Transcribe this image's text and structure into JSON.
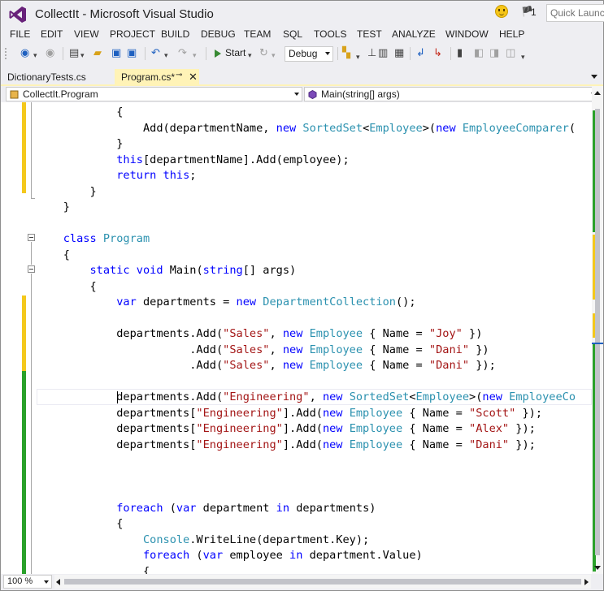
{
  "window": {
    "title": "CollectIt - Microsoft Visual Studio",
    "notification_count": "1",
    "quick_launch_placeholder": "Quick Launch"
  },
  "menu": [
    "FILE",
    "EDIT",
    "VIEW",
    "PROJECT",
    "BUILD",
    "DEBUG",
    "TEAM",
    "SQL",
    "TOOLS",
    "TEST",
    "ANALYZE",
    "WINDOW",
    "HELP"
  ],
  "toolbar": {
    "start_label": "Start",
    "configuration": "Debug"
  },
  "tabs": [
    {
      "label": "DictionaryTests.cs",
      "active": false
    },
    {
      "label": "Program.cs*",
      "active": true
    }
  ],
  "navbar": {
    "type_scope": "CollectIt.Program",
    "member_scope": "Main(string[] args)"
  },
  "editor": {
    "zoom": "100 %",
    "lines": [
      [
        {
          "t": "            {",
          "c": ""
        }
      ],
      [
        {
          "t": "                Add(departmentName, ",
          "c": ""
        },
        {
          "t": "new",
          "c": "kw"
        },
        {
          "t": " ",
          "c": ""
        },
        {
          "t": "SortedSet",
          "c": "ty"
        },
        {
          "t": "<",
          "c": ""
        },
        {
          "t": "Employee",
          "c": "ty"
        },
        {
          "t": ">(",
          "c": ""
        },
        {
          "t": "new",
          "c": "kw"
        },
        {
          "t": " ",
          "c": ""
        },
        {
          "t": "EmployeeComparer",
          "c": "ty"
        },
        {
          "t": "(",
          "c": ""
        }
      ],
      [
        {
          "t": "            }",
          "c": ""
        }
      ],
      [
        {
          "t": "            ",
          "c": ""
        },
        {
          "t": "this",
          "c": "kw"
        },
        {
          "t": "[departmentName].Add(employee);",
          "c": ""
        }
      ],
      [
        {
          "t": "            ",
          "c": ""
        },
        {
          "t": "return",
          "c": "kw"
        },
        {
          "t": " ",
          "c": ""
        },
        {
          "t": "this",
          "c": "kw"
        },
        {
          "t": ";",
          "c": ""
        }
      ],
      [
        {
          "t": "        }",
          "c": ""
        }
      ],
      [
        {
          "t": "    }",
          "c": ""
        }
      ],
      [
        {
          "t": "",
          "c": ""
        }
      ],
      [
        {
          "t": "    ",
          "c": ""
        },
        {
          "t": "class",
          "c": "kw"
        },
        {
          "t": " ",
          "c": ""
        },
        {
          "t": "Program",
          "c": "ty"
        }
      ],
      [
        {
          "t": "    {",
          "c": ""
        }
      ],
      [
        {
          "t": "        ",
          "c": ""
        },
        {
          "t": "static",
          "c": "kw"
        },
        {
          "t": " ",
          "c": ""
        },
        {
          "t": "void",
          "c": "kw"
        },
        {
          "t": " Main(",
          "c": ""
        },
        {
          "t": "string",
          "c": "kw"
        },
        {
          "t": "[] args)",
          "c": ""
        }
      ],
      [
        {
          "t": "        {",
          "c": ""
        }
      ],
      [
        {
          "t": "            ",
          "c": ""
        },
        {
          "t": "var",
          "c": "kw"
        },
        {
          "t": " departments = ",
          "c": ""
        },
        {
          "t": "new",
          "c": "kw"
        },
        {
          "t": " ",
          "c": ""
        },
        {
          "t": "DepartmentCollection",
          "c": "ty"
        },
        {
          "t": "();",
          "c": ""
        }
      ],
      [
        {
          "t": "",
          "c": ""
        }
      ],
      [
        {
          "t": "            departments.Add(",
          "c": ""
        },
        {
          "t": "\"Sales\"",
          "c": "str"
        },
        {
          "t": ", ",
          "c": ""
        },
        {
          "t": "new",
          "c": "kw"
        },
        {
          "t": " ",
          "c": ""
        },
        {
          "t": "Employee",
          "c": "ty"
        },
        {
          "t": " { Name = ",
          "c": ""
        },
        {
          "t": "\"Joy\"",
          "c": "str"
        },
        {
          "t": " })",
          "c": ""
        }
      ],
      [
        {
          "t": "                       .Add(",
          "c": ""
        },
        {
          "t": "\"Sales\"",
          "c": "str"
        },
        {
          "t": ", ",
          "c": ""
        },
        {
          "t": "new",
          "c": "kw"
        },
        {
          "t": " ",
          "c": ""
        },
        {
          "t": "Employee",
          "c": "ty"
        },
        {
          "t": " { Name = ",
          "c": ""
        },
        {
          "t": "\"Dani\"",
          "c": "str"
        },
        {
          "t": " })",
          "c": ""
        }
      ],
      [
        {
          "t": "                       .Add(",
          "c": ""
        },
        {
          "t": "\"Sales\"",
          "c": "str"
        },
        {
          "t": ", ",
          "c": ""
        },
        {
          "t": "new",
          "c": "kw"
        },
        {
          "t": " ",
          "c": ""
        },
        {
          "t": "Employee",
          "c": "ty"
        },
        {
          "t": " { Name = ",
          "c": ""
        },
        {
          "t": "\"Dani\"",
          "c": "str"
        },
        {
          "t": " });",
          "c": ""
        }
      ],
      [
        {
          "t": "",
          "c": ""
        }
      ],
      [
        {
          "t": "            departments.Add(",
          "c": ""
        },
        {
          "t": "\"Engineering\"",
          "c": "str"
        },
        {
          "t": ", ",
          "c": ""
        },
        {
          "t": "new",
          "c": "kw"
        },
        {
          "t": " ",
          "c": ""
        },
        {
          "t": "SortedSet",
          "c": "ty"
        },
        {
          "t": "<",
          "c": ""
        },
        {
          "t": "Employee",
          "c": "ty"
        },
        {
          "t": ">(",
          "c": ""
        },
        {
          "t": "new",
          "c": "kw"
        },
        {
          "t": " ",
          "c": ""
        },
        {
          "t": "EmployeeCo",
          "c": "ty"
        }
      ],
      [
        {
          "t": "            departments[",
          "c": ""
        },
        {
          "t": "\"Engineering\"",
          "c": "str"
        },
        {
          "t": "].Add(",
          "c": ""
        },
        {
          "t": "new",
          "c": "kw"
        },
        {
          "t": " ",
          "c": ""
        },
        {
          "t": "Employee",
          "c": "ty"
        },
        {
          "t": " { Name = ",
          "c": ""
        },
        {
          "t": "\"Scott\"",
          "c": "str"
        },
        {
          "t": " });",
          "c": ""
        }
      ],
      [
        {
          "t": "            departments[",
          "c": ""
        },
        {
          "t": "\"Engineering\"",
          "c": "str"
        },
        {
          "t": "].Add(",
          "c": ""
        },
        {
          "t": "new",
          "c": "kw"
        },
        {
          "t": " ",
          "c": ""
        },
        {
          "t": "Employee",
          "c": "ty"
        },
        {
          "t": " { Name = ",
          "c": ""
        },
        {
          "t": "\"Alex\"",
          "c": "str"
        },
        {
          "t": " });",
          "c": ""
        }
      ],
      [
        {
          "t": "            departments[",
          "c": ""
        },
        {
          "t": "\"Engineering\"",
          "c": "str"
        },
        {
          "t": "].Add(",
          "c": ""
        },
        {
          "t": "new",
          "c": "kw"
        },
        {
          "t": " ",
          "c": ""
        },
        {
          "t": "Employee",
          "c": "ty"
        },
        {
          "t": " { Name = ",
          "c": ""
        },
        {
          "t": "\"Dani\"",
          "c": "str"
        },
        {
          "t": " });",
          "c": ""
        }
      ],
      [
        {
          "t": "",
          "c": ""
        }
      ],
      [
        {
          "t": "",
          "c": ""
        }
      ],
      [
        {
          "t": "",
          "c": ""
        }
      ],
      [
        {
          "t": "            ",
          "c": ""
        },
        {
          "t": "foreach",
          "c": "kw"
        },
        {
          "t": " (",
          "c": ""
        },
        {
          "t": "var",
          "c": "kw"
        },
        {
          "t": " department ",
          "c": ""
        },
        {
          "t": "in",
          "c": "kw"
        },
        {
          "t": " departments)",
          "c": ""
        }
      ],
      [
        {
          "t": "            {",
          "c": ""
        }
      ],
      [
        {
          "t": "                ",
          "c": ""
        },
        {
          "t": "Console",
          "c": "ty"
        },
        {
          "t": ".WriteLine(department.Key);",
          "c": ""
        }
      ],
      [
        {
          "t": "                ",
          "c": ""
        },
        {
          "t": "foreach",
          "c": "kw"
        },
        {
          "t": " (",
          "c": ""
        },
        {
          "t": "var",
          "c": "kw"
        },
        {
          "t": " employee ",
          "c": ""
        },
        {
          "t": "in",
          "c": "kw"
        },
        {
          "t": " department.Value)",
          "c": ""
        }
      ],
      [
        {
          "t": "                {",
          "c": ""
        }
      ]
    ]
  },
  "colors": {
    "change_saved": "#2aa12a",
    "change_unsaved": "#f4c81c",
    "active_tab": "#fff3b7",
    "keyword": "#0000ff",
    "type": "#2b91af",
    "string": "#a31515"
  }
}
